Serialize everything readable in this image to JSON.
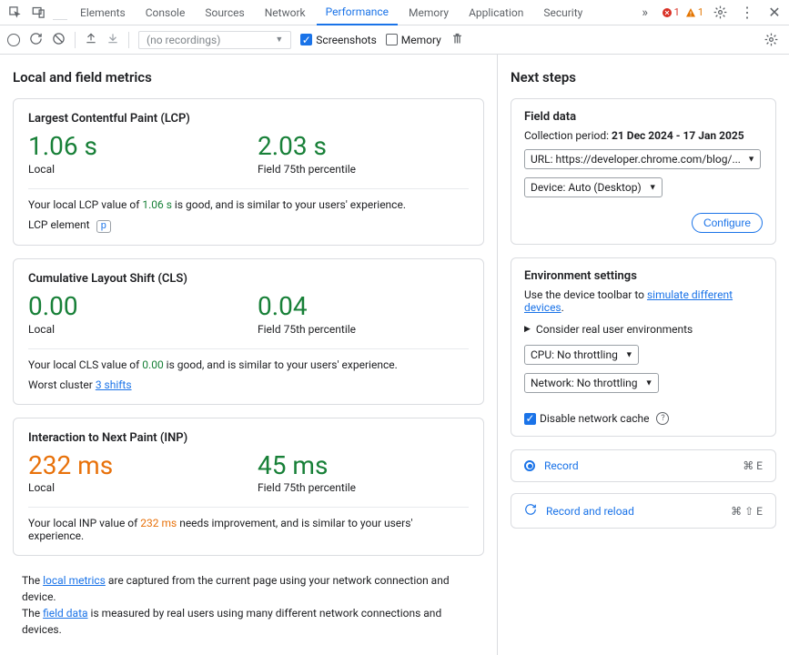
{
  "tabs": {
    "items": [
      "Elements",
      "Console",
      "Sources",
      "Network",
      "Performance",
      "Memory",
      "Application",
      "Security"
    ],
    "active": "Performance",
    "errors": "1",
    "warnings": "1"
  },
  "toolbar": {
    "recordings": "(no recordings)",
    "screenshots": "Screenshots",
    "memory": "Memory"
  },
  "left": {
    "heading": "Local and field metrics",
    "lcp": {
      "title": "Largest Contentful Paint (LCP)",
      "local_val": "1.06 s",
      "local_label": "Local",
      "field_val": "2.03 s",
      "field_label": "Field 75th percentile",
      "desc_pre": "Your local LCP value of ",
      "desc_val": "1.06 s",
      "desc_post": " is good, and is similar to your users' experience.",
      "extra_label": "LCP element",
      "extra_badge": "p"
    },
    "cls": {
      "title": "Cumulative Layout Shift (CLS)",
      "local_val": "0.00",
      "local_label": "Local",
      "field_val": "0.04",
      "field_label": "Field 75th percentile",
      "desc_pre": "Your local CLS value of ",
      "desc_val": "0.00",
      "desc_post": " is good, and is similar to your users' experience.",
      "extra_label": "Worst cluster ",
      "extra_link": "3 shifts"
    },
    "inp": {
      "title": "Interaction to Next Paint (INP)",
      "local_val": "232 ms",
      "local_label": "Local",
      "field_val": "45 ms",
      "field_label": "Field 75th percentile",
      "desc_pre": "Your local INP value of ",
      "desc_val": "232 ms",
      "desc_post": " needs improvement, and is similar to your users' experience."
    },
    "footer": {
      "l1a": "The ",
      "l1_link": "local metrics",
      "l1b": " are captured from the current page using your network connection and device.",
      "l2a": "The ",
      "l2_link": "field data",
      "l2b": " is measured by real users using many different network connections and devices."
    }
  },
  "right": {
    "heading": "Next steps",
    "field": {
      "title": "Field data",
      "period_label": "Collection period: ",
      "period": "21 Dec 2024 - 17 Jan 2025",
      "url": "URL: https://developer.chrome.com/blog/...",
      "device": "Device: Auto (Desktop)",
      "configure": "Configure"
    },
    "env": {
      "title": "Environment settings",
      "text_pre": "Use the device toolbar to ",
      "text_link": "simulate different devices",
      "text_post": ".",
      "consider": "Consider real user environments",
      "cpu": "CPU: No throttling",
      "net": "Network: No throttling",
      "disable_cache": "Disable network cache"
    },
    "record": {
      "label": "Record",
      "shortcut": "⌘ E"
    },
    "reload": {
      "label": "Record and reload",
      "shortcut": "⌘ ⇧ E"
    }
  }
}
